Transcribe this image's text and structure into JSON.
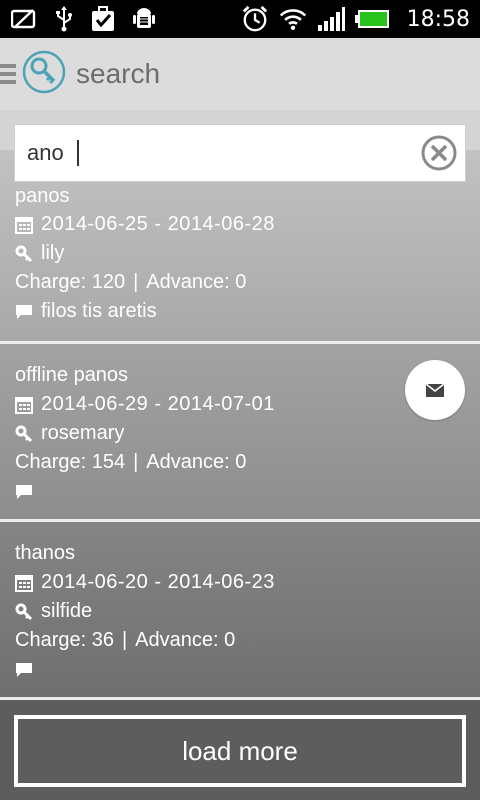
{
  "status_bar": {
    "time": "18:58",
    "icons": [
      "screen-off-icon",
      "usb-icon",
      "checkbox-icon",
      "android-debug-icon",
      "alarm-icon",
      "wifi-icon",
      "signal-icon",
      "battery-icon"
    ]
  },
  "header": {
    "title": "search",
    "icon": "key-logo-icon"
  },
  "search": {
    "value": "ano",
    "clear_icon": "clear-icon"
  },
  "items": [
    {
      "name": "panos",
      "dates": "2014-06-25  -  2014-06-28",
      "room": "lily",
      "charge": "Charge: 120",
      "advance": "Advance: 0",
      "note": "filos tis aretis"
    },
    {
      "name": "offline panos",
      "dates": "2014-06-29  -  2014-07-01",
      "room": "rosemary",
      "charge": "Charge: 154",
      "advance": "Advance: 0",
      "note": ""
    },
    {
      "name": "thanos",
      "dates": "2014-06-20  -  2014-06-23",
      "room": "silfide",
      "charge": "Charge: 36",
      "advance": "Advance: 0",
      "note": ""
    }
  ],
  "footer": {
    "load_more": "load more"
  },
  "colors": {
    "accent": "#4aa3b5",
    "status_bar": "#000000",
    "action_bar": "#dcdcdc"
  }
}
